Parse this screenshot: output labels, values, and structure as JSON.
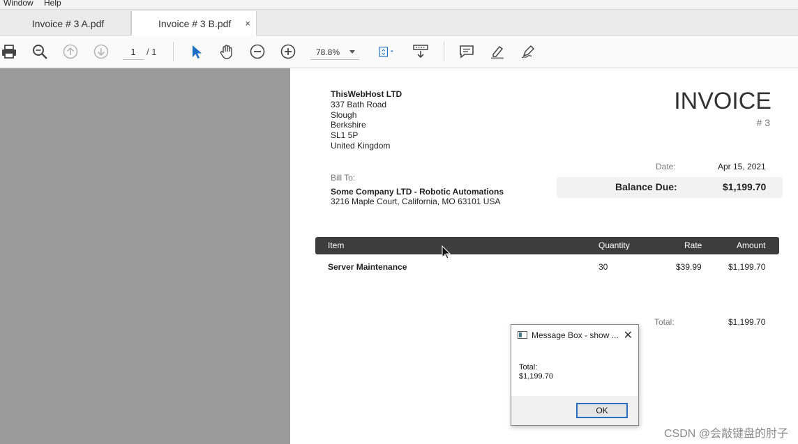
{
  "menu": {
    "window": "Window",
    "help": "Help"
  },
  "tabs": [
    {
      "label": "Invoice # 3 A.pdf"
    },
    {
      "label": "Invoice # 3 B.pdf",
      "close": "×"
    }
  ],
  "toolbar": {
    "page_current": "1",
    "page_total": "/ 1",
    "zoom": "78.8%"
  },
  "invoice": {
    "company": {
      "name": "ThisWebHost LTD",
      "address_lines": [
        "337 Bath Road",
        "Slough",
        "Berkshire",
        "SL1 5P",
        "United Kingdom"
      ]
    },
    "title": "INVOICE",
    "number": "# 3",
    "date_label": "Date:",
    "date_value": "Apr 15, 2021",
    "balance_label": "Balance Due:",
    "balance_value": "$1,199.70",
    "bill_to_label": "Bill To:",
    "bill_to_name": "Some Company LTD - Robotic Automations",
    "bill_to_address": "3216 Maple Court, California, MO 63101 USA",
    "table_headers": {
      "item": "Item",
      "quantity": "Quantity",
      "rate": "Rate",
      "amount": "Amount"
    },
    "rows": [
      {
        "item": "Server Maintenance",
        "quantity": "30",
        "rate": "$39.99",
        "amount": "$1,199.70"
      }
    ],
    "total_label": "Total:",
    "total_value": "$1,199.70"
  },
  "message_box": {
    "title": "Message Box - show ...",
    "close": "✕",
    "line1": "Total:",
    "line2": "$1,199.70",
    "ok_label": "OK"
  },
  "watermark": "CSDN @会敲键盘的肘子"
}
